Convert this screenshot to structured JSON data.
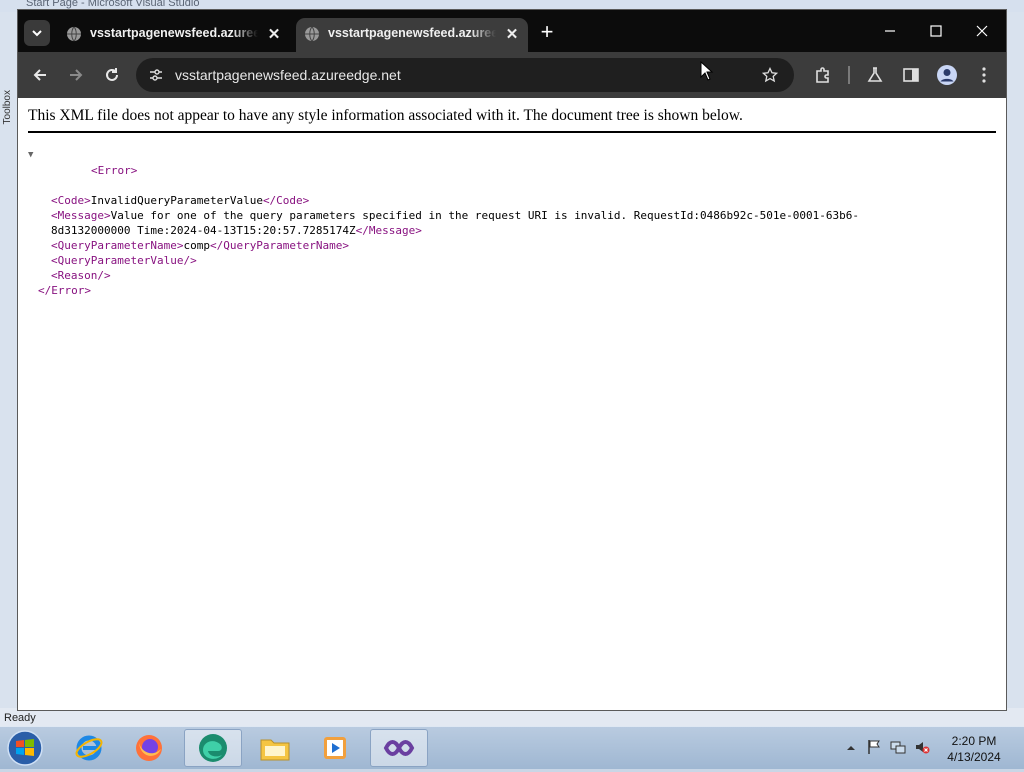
{
  "background_window": {
    "title": "Start Page - Microsoft Visual Studio",
    "toolbox_label": "Toolbox",
    "status": "Ready"
  },
  "browser": {
    "tabs": [
      {
        "title": "vsstartpagenewsfeed.azureedge.net",
        "active": false
      },
      {
        "title": "vsstartpagenewsfeed.azureedge.net",
        "active": true
      }
    ],
    "url": "vsstartpagenewsfeed.azureedge.net"
  },
  "page": {
    "notice": "This XML file does not appear to have any style information associated with it. The document tree is shown below.",
    "xml": {
      "root_open": "<Error>",
      "root_close": "</Error>",
      "code_open": "<Code>",
      "code_value": "InvalidQueryParameterValue",
      "code_close": "</Code>",
      "message_open": "<Message>",
      "message_value_line1": "Value for one of the query parameters specified in the request URI is invalid. RequestId:0486b92c-501e-0001-63b6-",
      "message_value_line2": "8d3132000000 Time:2024-04-13T15:20:57.7285174Z",
      "message_close": "</Message>",
      "qpn_open": "<QueryParameterName>",
      "qpn_value": "comp",
      "qpn_close": "</QueryParameterName>",
      "qpv_empty": "<QueryParameterValue/>",
      "reason_empty": "<Reason/>"
    }
  },
  "taskbar": {
    "apps": [
      "internet-explorer",
      "firefox",
      "edge-dev",
      "file-explorer",
      "media-player",
      "visual-studio"
    ],
    "time": "2:20 PM",
    "date": "4/13/2024"
  }
}
